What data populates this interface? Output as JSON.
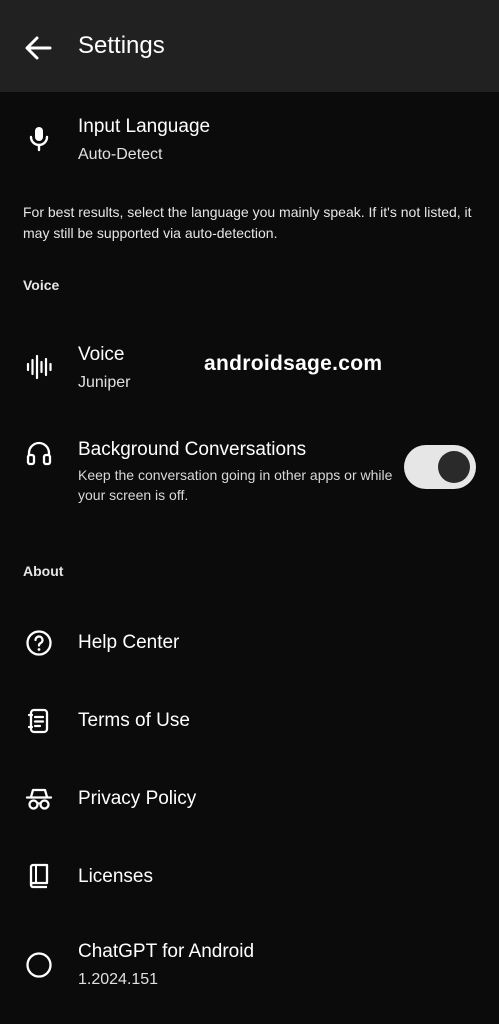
{
  "header": {
    "title": "Settings"
  },
  "input_language": {
    "title": "Input Language",
    "value": "Auto-Detect"
  },
  "helper_text": "For best results, select the language you mainly speak. If it's not listed, it may still be supported via auto-detection.",
  "sections": {
    "voice": "Voice",
    "about": "About"
  },
  "voice_row": {
    "title": "Voice",
    "value": "Juniper"
  },
  "background_conversations": {
    "title": "Background Conversations",
    "description": "Keep the conversation going in other apps or while your screen is off.",
    "enabled": true
  },
  "watermark": "androidsage.com",
  "about_items": {
    "help": "Help Center",
    "terms": "Terms of Use",
    "privacy": "Privacy Policy",
    "licenses": "Licenses"
  },
  "app_info": {
    "title": "ChatGPT for Android",
    "version": "1.2024.151"
  },
  "icons": [
    "back-arrow-icon",
    "microphone-icon",
    "waveform-icon",
    "headphones-icon",
    "help-circle-icon",
    "document-icon",
    "incognito-icon",
    "book-icon",
    "circle-icon"
  ]
}
